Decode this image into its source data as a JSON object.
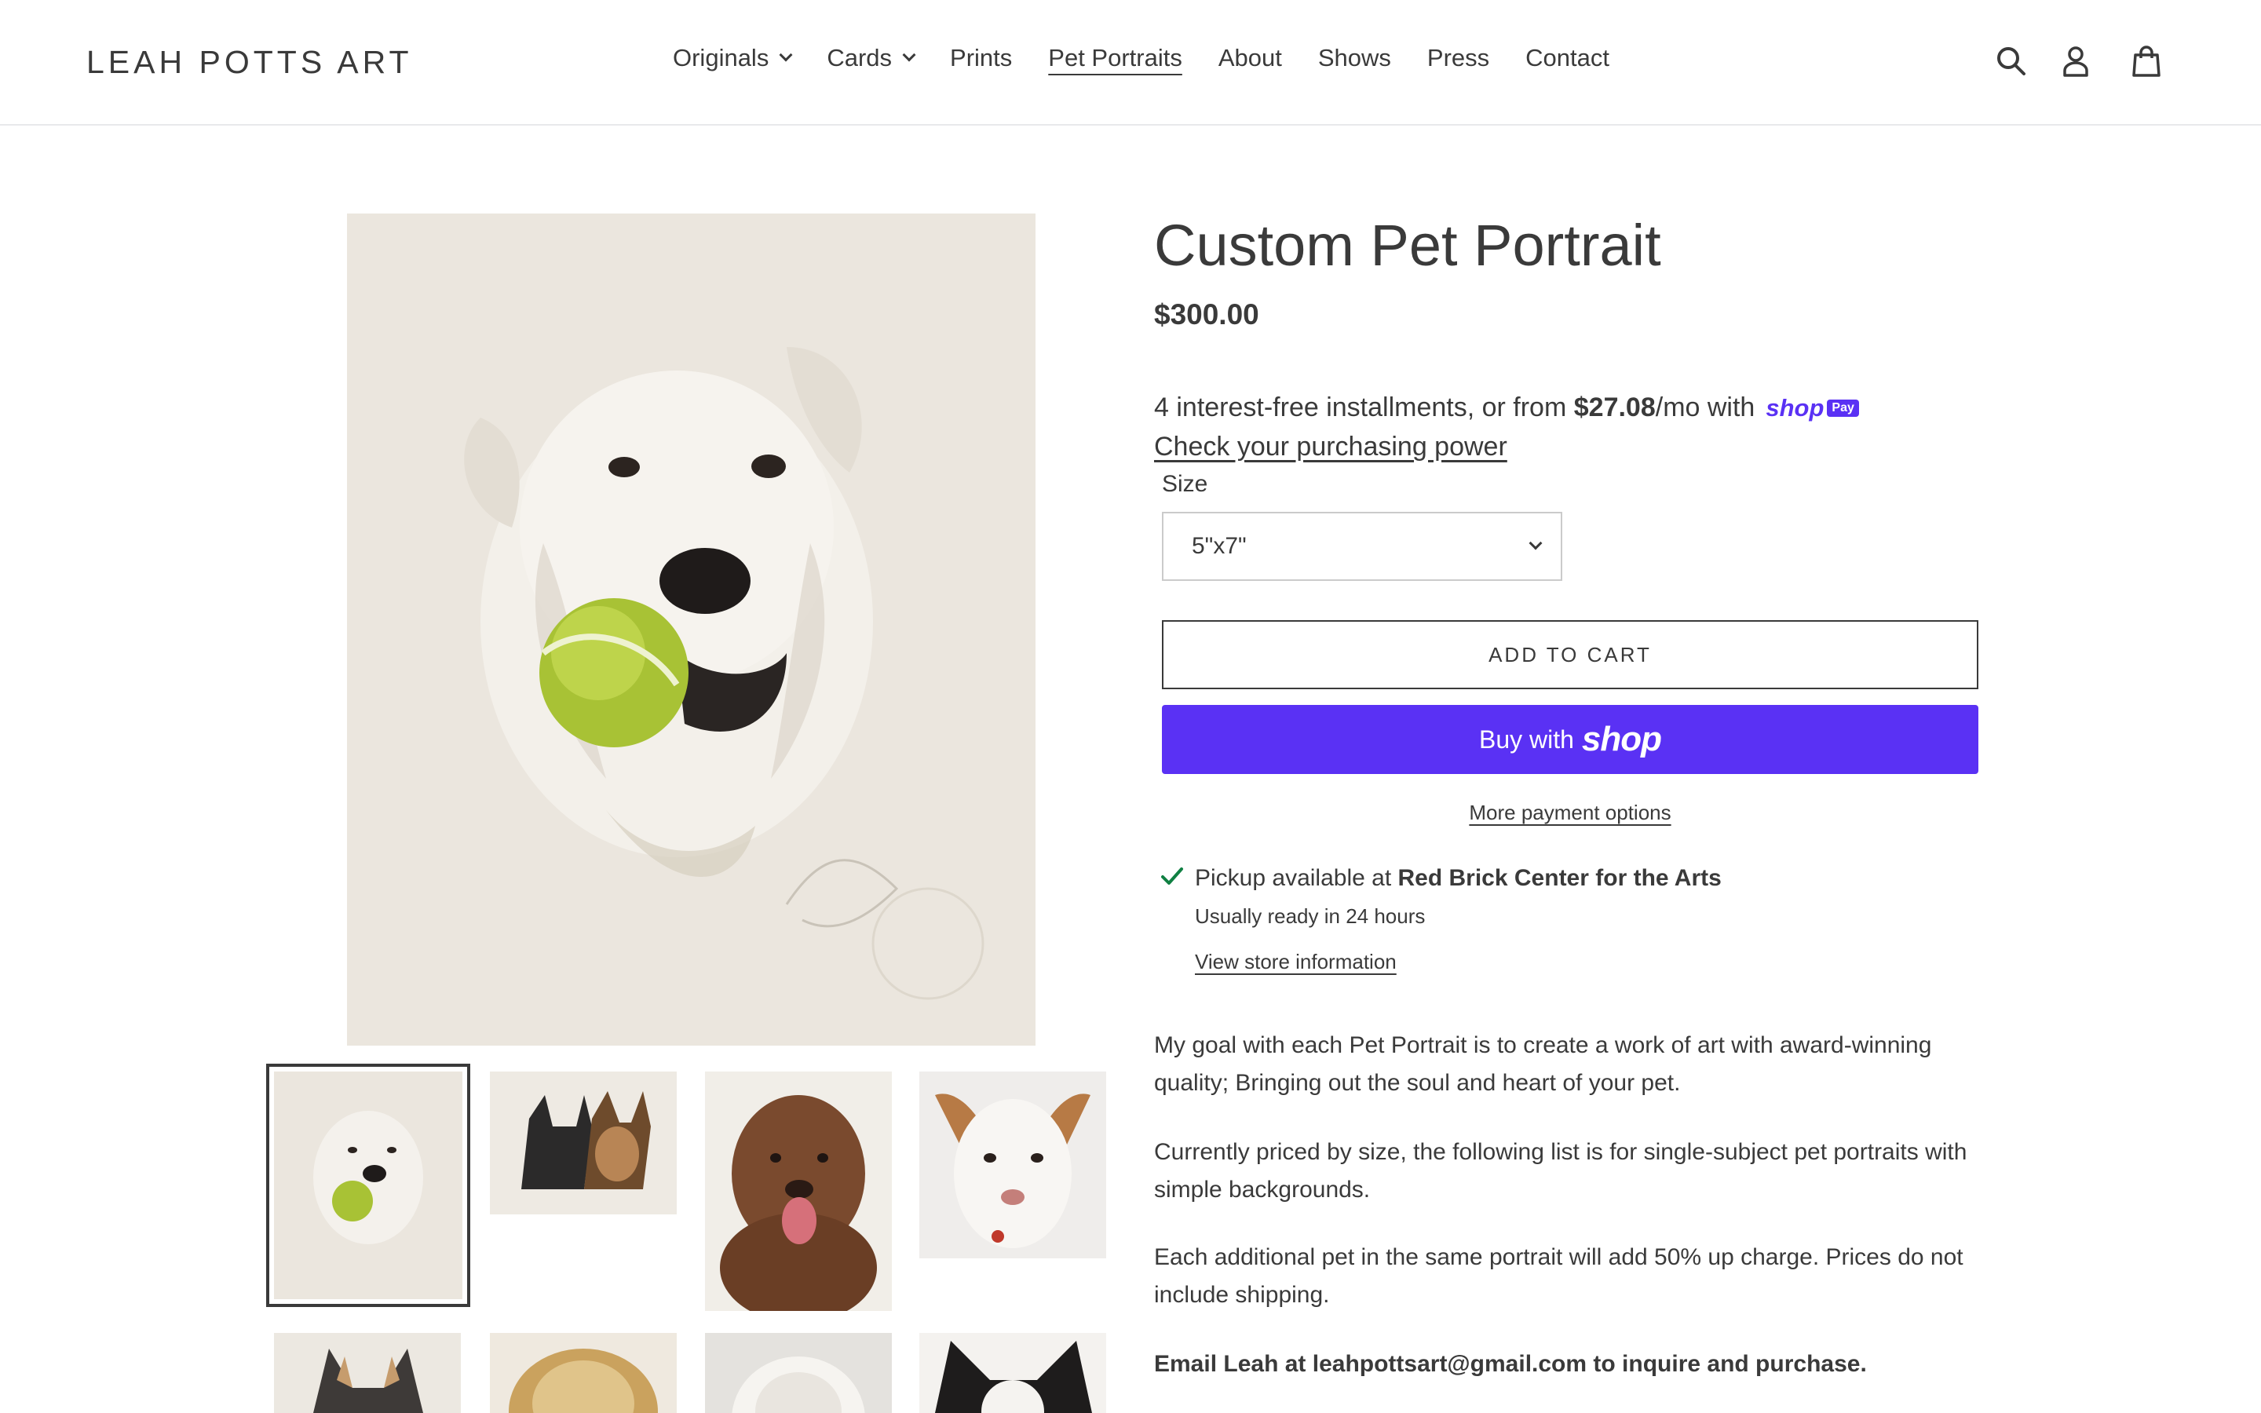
{
  "header": {
    "logo": "LEAH POTTS ART",
    "nav": [
      {
        "label": "Originals"
      },
      {
        "label": "Cards"
      },
      {
        "label": "Prints"
      },
      {
        "label": "Pet Portraits"
      },
      {
        "label": "About"
      },
      {
        "label": "Shows"
      },
      {
        "label": "Press"
      },
      {
        "label": "Contact"
      }
    ],
    "icons": [
      "search-icon",
      "account-icon",
      "cart-icon"
    ]
  },
  "product": {
    "title": "Custom Pet Portrait",
    "price": "$300.00",
    "installments": {
      "prefix": "4 interest-free installments, or from ",
      "amount": "$27.08",
      "suffix": "/mo with",
      "shop_word": "shop",
      "pay_word": "Pay",
      "link": "Check your purchasing power"
    },
    "size": {
      "label": "Size",
      "selected": "5\"x7\""
    },
    "add_to_cart": "ADD TO CART",
    "buy_with": "Buy with",
    "buy_shop_word": "shop",
    "more_payment": "More payment options",
    "pickup": {
      "prefix": "Pickup available at ",
      "location": "Red Brick Center for the Arts",
      "ready": "Usually ready in 24 hours",
      "store_link": "View store information"
    },
    "description": [
      "My goal with each Pet Portrait is to create a work of art with award-winning quality; Bringing out the soul and heart of your pet.",
      "Currently priced by size, the following list is for single-subject pet portraits with simple backgrounds.",
      "Each additional pet in the same portrait will add 50% up charge. Prices do not include shipping.",
      "Email Leah at leahpottsart@gmail.com to inquire and purchase."
    ]
  },
  "colors": {
    "text": "#3a3a3a",
    "shop_purple": "#5a31f4",
    "border": "#e8e9eb",
    "check_green": "#108043"
  }
}
